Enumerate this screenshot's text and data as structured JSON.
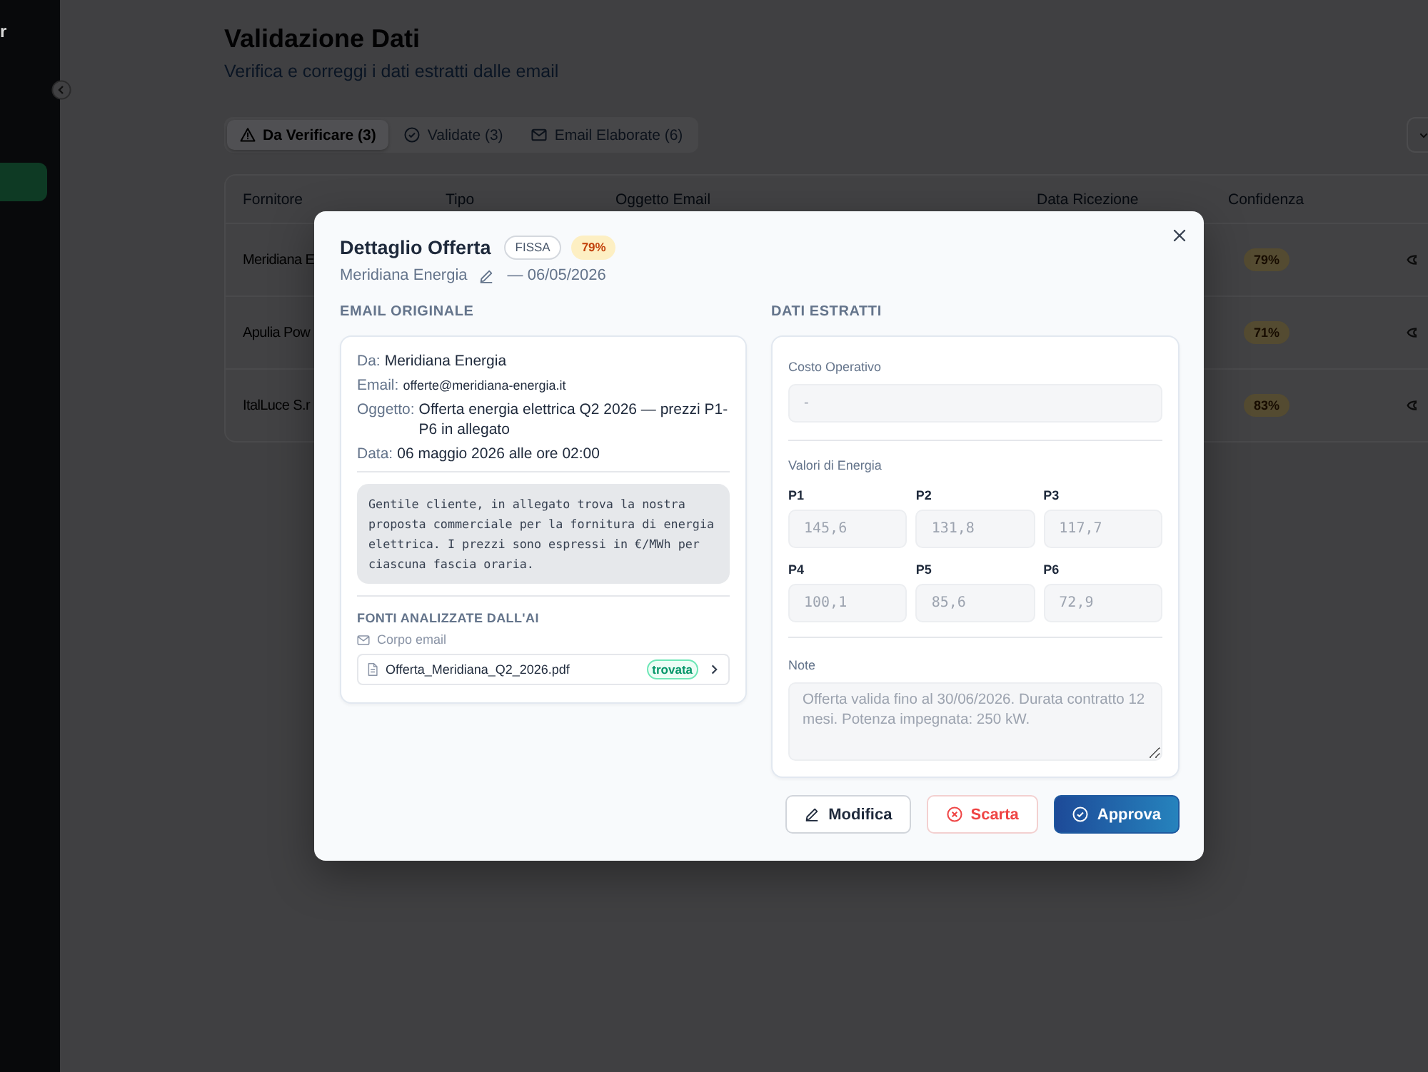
{
  "sidebar": {
    "title": "r",
    "nav_items": [
      {
        "selected": true
      }
    ]
  },
  "page": {
    "title": "Validazione Dati",
    "subtitle": "Verifica e correggi i dati estratti dalle email"
  },
  "tabs": [
    {
      "label": "Da Verificare (3)",
      "selected": true
    },
    {
      "label": "Validate (3)",
      "selected": false
    },
    {
      "label": "Email Elaborate (6)",
      "selected": false
    }
  ],
  "table": {
    "columns": [
      "Fornitore",
      "Tipo",
      "Oggetto Email",
      "Data Ricezione",
      "Confidenza"
    ],
    "rows": [
      {
        "supplier": "Meridiana E",
        "confidence": "79%"
      },
      {
        "supplier": "Apulia Pow",
        "confidence": "71%"
      },
      {
        "supplier": "ItalLuce S.r",
        "confidence": "83%"
      }
    ]
  },
  "modal": {
    "title": "Dettaglio Offerta",
    "badges": [
      {
        "text": "FISSA",
        "kind": "type"
      },
      {
        "text": "79%",
        "kind": "confidence"
      }
    ],
    "supplier": "Meridiana Energia",
    "date": "— 06/05/2026",
    "email": {
      "heading": "EMAIL ORIGINALE",
      "fields": [
        {
          "label": "Da:",
          "value": "Meridiana Energia",
          "kind": "text"
        },
        {
          "label": "Email:",
          "value": "offerte@meridiana-energia.it",
          "kind": "address"
        },
        {
          "label": "Oggetto:",
          "value": "Offerta energia elettrica Q2 2026 — prezzi P1-P6 in allegato",
          "kind": "text"
        },
        {
          "label": "Data:",
          "value": "06 maggio 2026 alle ore 02:00",
          "kind": "text"
        }
      ],
      "body": "Gentile cliente, in allegato trova la nostra proposta commerciale per la fornitura di energia elettrica. I prezzi sono espressi in €/MWh per ciascuna fascia oraria.",
      "sources": {
        "heading": "FONTI ANALIZZATE DALL'AI",
        "items": [
          {
            "kind": "email",
            "label": "Corpo email"
          },
          {
            "kind": "file",
            "label": "Offerta_Meridiana_Q2_2026.pdf",
            "status": "trovata"
          }
        ]
      }
    },
    "extracted": {
      "heading": "DATI ESTRATTI",
      "disabled": true,
      "operating_cost": {
        "label": "Costo Operativo",
        "value": "-"
      },
      "energy": {
        "label": "Valori di Energia",
        "fields": [
          {
            "label": "P1",
            "value": "145,6"
          },
          {
            "label": "P2",
            "value": "131,8"
          },
          {
            "label": "P3",
            "value": "117,7"
          },
          {
            "label": "P4",
            "value": "100,1"
          },
          {
            "label": "P5",
            "value": "85,6"
          },
          {
            "label": "P6",
            "value": "72,9"
          }
        ]
      },
      "notes": {
        "label": "Note",
        "value": "Offerta valida fino al 30/06/2026. Durata contratto 12 mesi. Potenza impegnata: 250 kW."
      }
    },
    "buttons": [
      {
        "label": "Modifica",
        "kind": "secondary"
      },
      {
        "label": "Scarta",
        "kind": "danger"
      },
      {
        "label": "Approva",
        "kind": "primary"
      }
    ]
  }
}
